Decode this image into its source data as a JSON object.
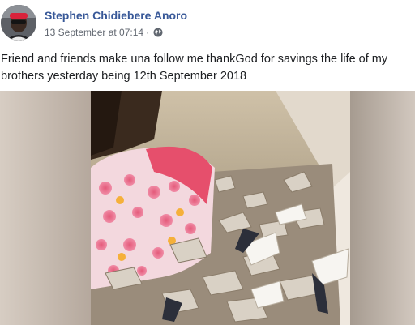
{
  "post": {
    "author_name": "Stephen Chidiebere Anoro",
    "timestamp": "13 September at 07:14",
    "separator": "·",
    "privacy_icon": "globe-icon",
    "text": "Friend and friends make una follow me thankGod for savings the life of my brothers yesterday being 12th September 2018"
  },
  "colors": {
    "author_link": "#385898",
    "meta_text": "#616770",
    "body_text": "#1c1e21"
  }
}
